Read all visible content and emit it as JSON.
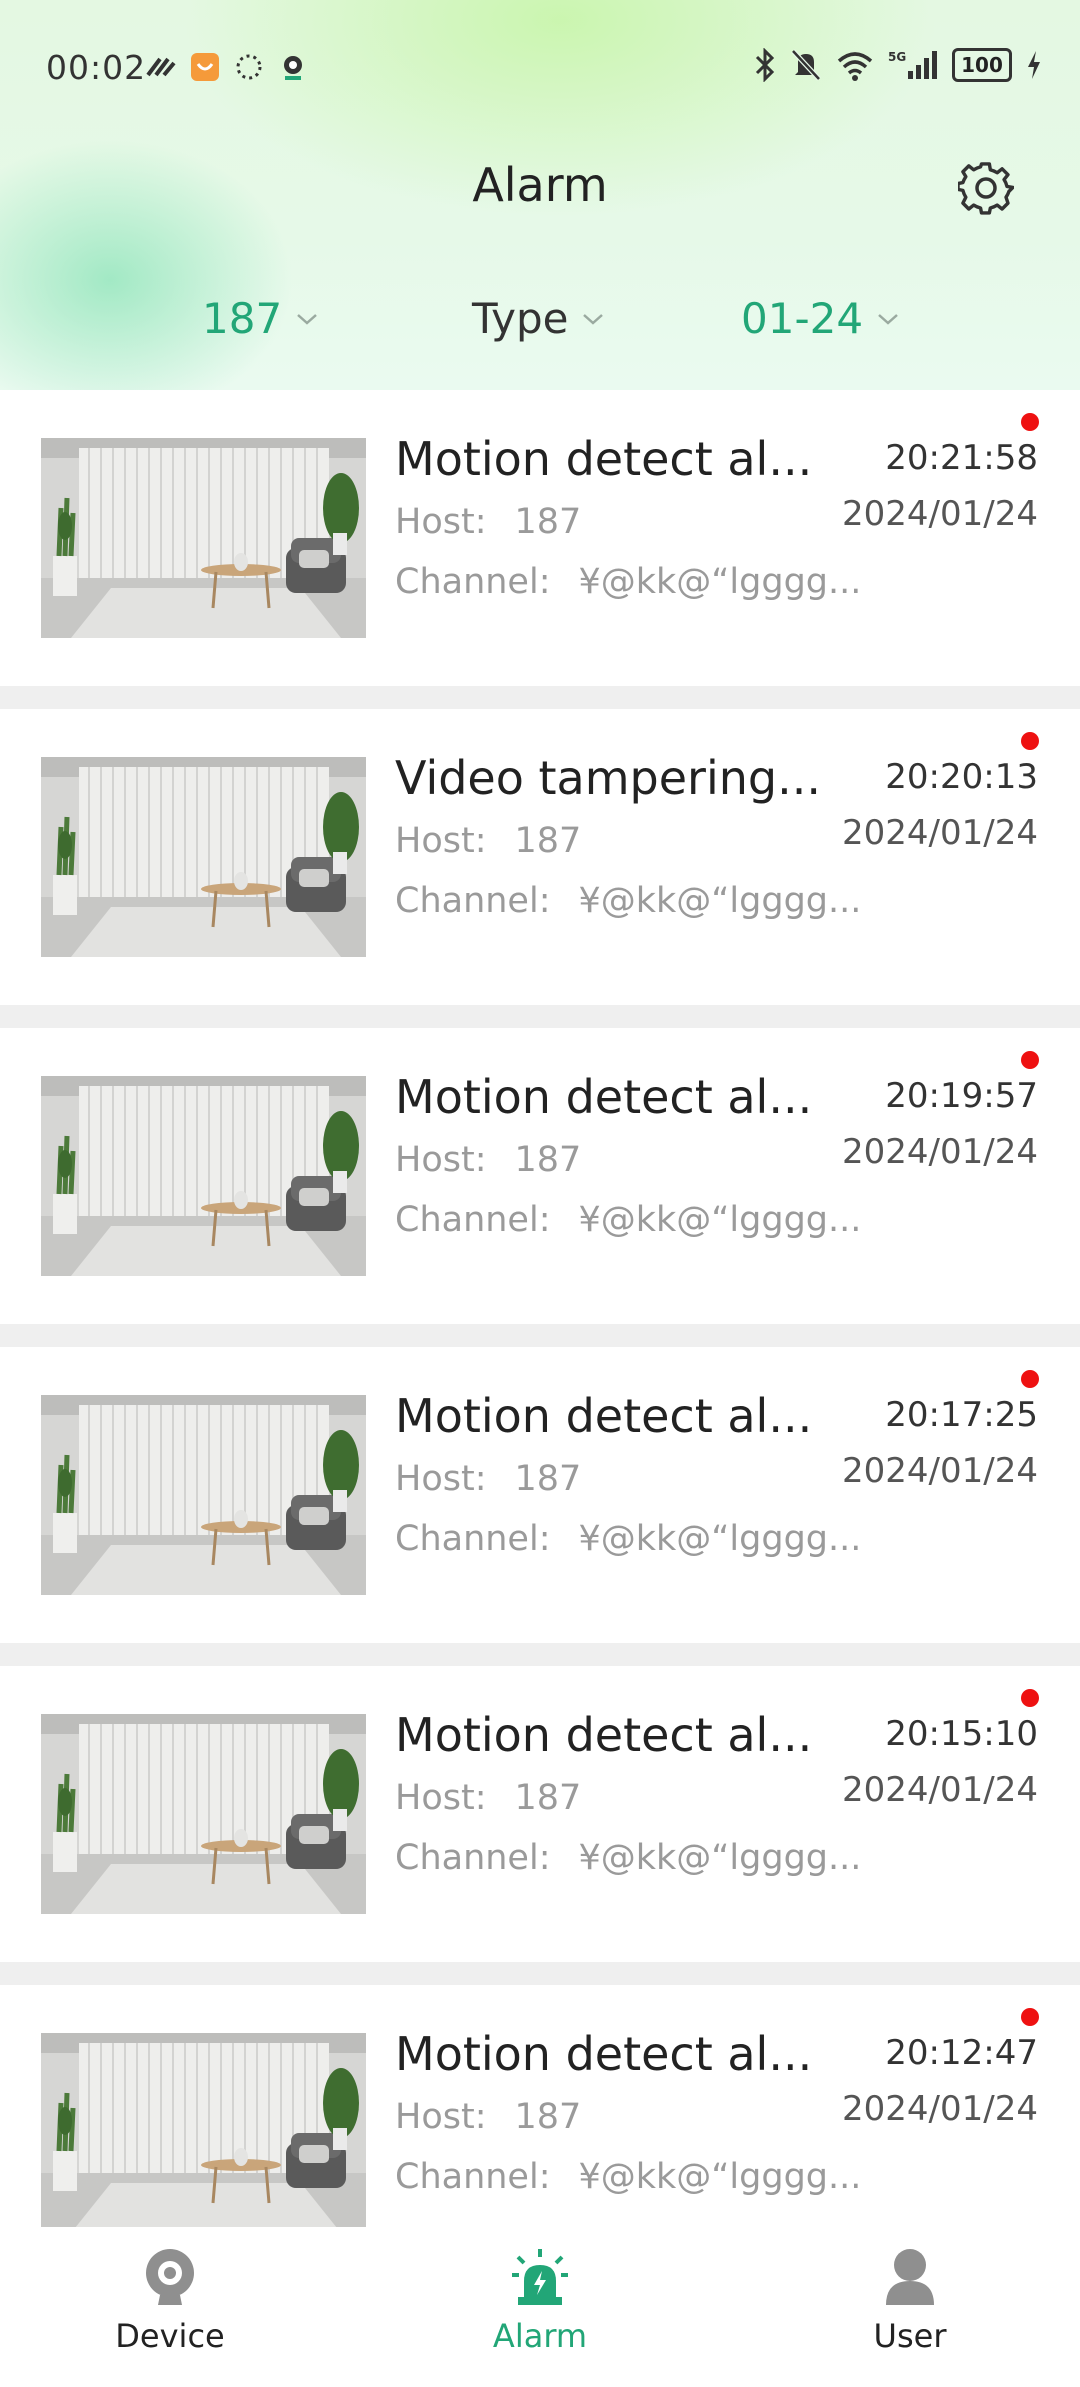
{
  "status_bar": {
    "time": "00:02",
    "battery": "100"
  },
  "header": {
    "title": "Alarm"
  },
  "filters": [
    {
      "label": "187",
      "color": "#22a677"
    },
    {
      "label": "Type",
      "color": "#333333"
    },
    {
      "label": "01-24",
      "color": "#22a677"
    }
  ],
  "labels": {
    "host": "Host:",
    "channel": "Channel:"
  },
  "alarms": [
    {
      "title": "Motion detect al...",
      "host": "187",
      "channel": "¥@kk@“lgggg...",
      "time": "20:21:58",
      "date": "2024/01/24",
      "unread": true
    },
    {
      "title": "Video tampering...",
      "host": "187",
      "channel": "¥@kk@“lgggg...",
      "time": "20:20:13",
      "date": "2024/01/24",
      "unread": true
    },
    {
      "title": "Motion detect al...",
      "host": "187",
      "channel": "¥@kk@“lgggg...",
      "time": "20:19:57",
      "date": "2024/01/24",
      "unread": true
    },
    {
      "title": "Motion detect al...",
      "host": "187",
      "channel": "¥@kk@“lgggg...",
      "time": "20:17:25",
      "date": "2024/01/24",
      "unread": true
    },
    {
      "title": "Motion detect al...",
      "host": "187",
      "channel": "¥@kk@“lgggg...",
      "time": "20:15:10",
      "date": "2024/01/24",
      "unread": true
    },
    {
      "title": "Motion detect al...",
      "host": "187",
      "channel": "¥@kk@“lgggg...",
      "time": "20:12:47",
      "date": "2024/01/24",
      "unread": true
    }
  ],
  "nav": [
    {
      "label": "Device",
      "icon": "camera-icon",
      "active": false
    },
    {
      "label": "Alarm",
      "icon": "alarm-siren-icon",
      "active": true
    },
    {
      "label": "User",
      "icon": "user-icon",
      "active": false
    }
  ],
  "colors": {
    "accent": "#22a677",
    "unread_dot": "#ee1111"
  }
}
